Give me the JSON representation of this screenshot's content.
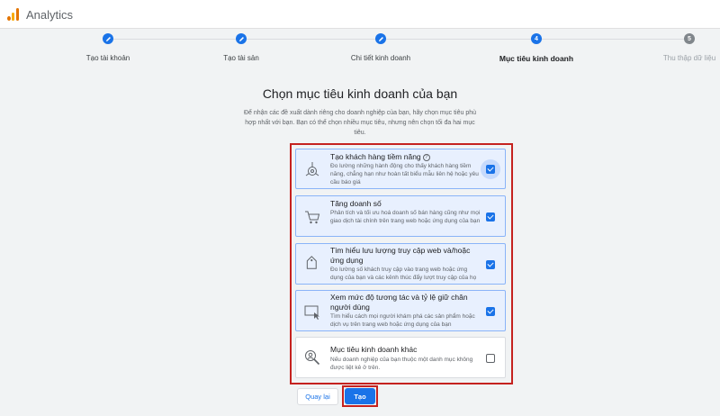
{
  "app": {
    "title": "Analytics"
  },
  "steps": [
    {
      "label": "Tạo tài khoản",
      "number": "",
      "state": "done"
    },
    {
      "label": "Tạo tài sản",
      "number": "",
      "state": "done"
    },
    {
      "label": "Chi tiết kinh doanh",
      "number": "",
      "state": "done"
    },
    {
      "label": "Mục tiêu kinh doanh",
      "number": "4",
      "state": "active"
    },
    {
      "label": "Thu thập dữ liệu",
      "number": "5",
      "state": "pending"
    }
  ],
  "main": {
    "heading": "Chọn mục tiêu kinh doanh của bạn",
    "description": "Để nhận các đề xuất dành riêng cho doanh nghiệp của bạn, hãy chọn mục tiêu phù hợp nhất với bạn. Bạn có thể chọn nhiều mục tiêu, nhưng nên chọn tối đa hai mục tiêu."
  },
  "objectives": [
    {
      "title": "Tạo khách hàng tiềm năng",
      "text": "Đo lường những hành động cho thấy khách hàng tiềm năng, chẳng hạn như hoàn tất biểu mẫu liên hệ hoặc yêu cầu báo giá",
      "checked": true,
      "icon": "leads-target-icon"
    },
    {
      "title": "Tăng doanh số",
      "text": "Phân tích và tối ưu hoá doanh số bán hàng cũng như mọi giao dịch tài chính trên trang web hoặc ứng dụng của bạn",
      "checked": true,
      "icon": "shopping-cart-icon"
    },
    {
      "title": "Tìm hiểu lưu lượng truy cập web và/hoặc ứng dụng",
      "text": "Đo lường số khách truy cập vào trang web hoặc ứng dụng của bạn và các kênh thúc đẩy lượt truy cập của họ",
      "checked": true,
      "icon": "tag-icon"
    },
    {
      "title": "Xem mức độ tương tác và tỷ lệ giữ chân người dùng",
      "text": "Tìm hiểu cách mọi người khám phá các sản phẩm hoặc dịch vụ trên trang web hoặc ứng dụng của bạn",
      "checked": true,
      "icon": "screen-cursor-icon"
    },
    {
      "title": "Mục tiêu kinh doanh khác",
      "text": "Nếu doanh nghiệp của bạn thuộc một danh mục không được liệt kê ở trên.",
      "checked": false,
      "icon": "search-person-icon"
    }
  ],
  "buttons": {
    "back": "Quay lại",
    "create": "Tạo"
  },
  "colors": {
    "accent": "#1a73e8",
    "highlight_border": "#c5221f",
    "selected_card": "#e8f0fe"
  }
}
